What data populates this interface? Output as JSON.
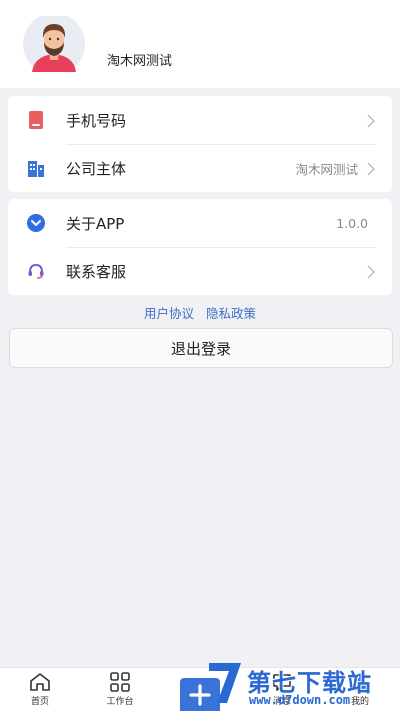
{
  "profile": {
    "username": "淘木网测试",
    "avatar_icon": "user-avatar-icon"
  },
  "menu": {
    "group1": [
      {
        "label": "手机号码",
        "value": "",
        "icon": "phone-icon",
        "color": "#e85d5d"
      },
      {
        "label": "公司主体",
        "value": "淘木网测试",
        "icon": "building-icon",
        "color": "#3a73d8"
      }
    ],
    "group2": [
      {
        "label": "关于APP",
        "value": "1.0.0",
        "icon": "chevron-circle-icon",
        "color": "#2f6fe0"
      },
      {
        "label": "联系客服",
        "value": "",
        "icon": "headset-icon",
        "color": "#7b5cd6"
      }
    ]
  },
  "links": {
    "user_agreement": "用户协议",
    "privacy_policy": "隐私政策"
  },
  "logout_label": "退出登录",
  "tabbar": {
    "home": "首页",
    "workbench": "工作台",
    "messages": "消息",
    "mine": "我的"
  },
  "watermark": {
    "text": "第七下载站",
    "url": "www.d7down.com"
  },
  "colors": {
    "accent": "#3a73d8",
    "link": "#3d6fc2",
    "background": "#f1f1f5"
  }
}
